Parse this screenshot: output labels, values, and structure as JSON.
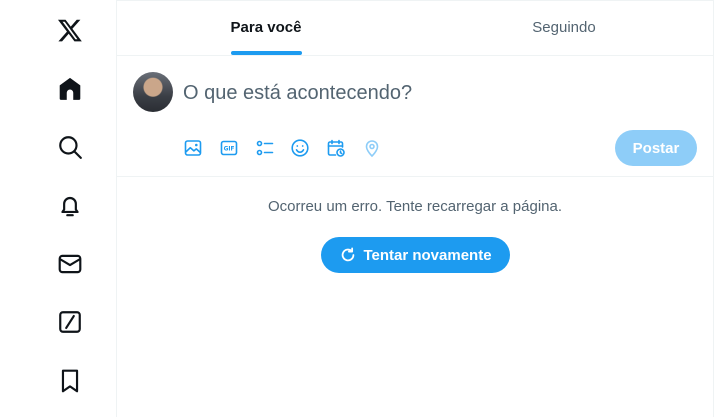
{
  "sidebar": {
    "items": [
      {
        "icon": "x-logo-icon"
      },
      {
        "icon": "home-icon"
      },
      {
        "icon": "search-icon"
      },
      {
        "icon": "bell-icon"
      },
      {
        "icon": "mail-icon"
      },
      {
        "icon": "grok-icon"
      },
      {
        "icon": "bookmark-icon"
      }
    ]
  },
  "tabs": [
    {
      "label": "Para você",
      "active": true
    },
    {
      "label": "Seguindo",
      "active": false
    }
  ],
  "composer": {
    "placeholder": "O que está acontecendo?",
    "toolbar": [
      "media-icon",
      "gif-icon",
      "poll-icon",
      "emoji-icon",
      "schedule-icon",
      "location-icon"
    ],
    "post_label": "Postar"
  },
  "error": {
    "message": "Ocorreu um erro. Tente recarregar a página.",
    "retry_label": "Tentar novamente"
  },
  "colors": {
    "accent": "#1d9bf0",
    "accent_disabled": "#8ecdf8",
    "text_primary": "#0f1419",
    "text_secondary": "#536471",
    "border": "#eff3f4"
  }
}
